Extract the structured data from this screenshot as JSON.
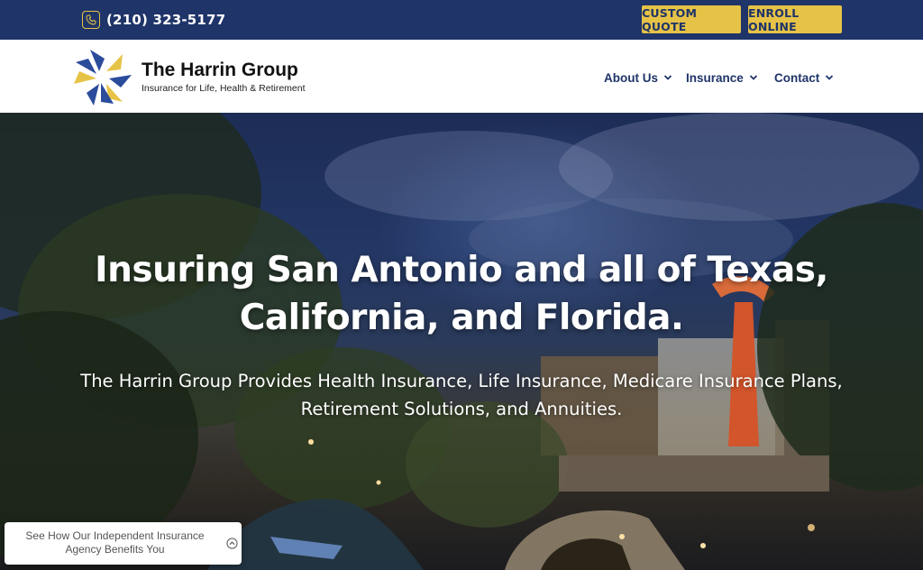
{
  "topbar": {
    "phone": "(210) 323-5177",
    "phone_icon": "phone-icon",
    "custom_quote_label": "CUSTOM QUOTE",
    "enroll_online_label": "ENROLL ONLINE"
  },
  "header": {
    "logo_title": "The Harrin Group",
    "logo_tagline": "Insurance for Life, Health & Retirement",
    "nav": [
      {
        "label": "About Us",
        "icon": "chevron-down-icon"
      },
      {
        "label": "Insurance",
        "icon": "chevron-down-icon"
      },
      {
        "label": "Contact",
        "icon": "chevron-down-icon"
      }
    ]
  },
  "hero": {
    "headline": "Insuring San Antonio and all of Texas, California, and Florida.",
    "subheadline": "The Harrin Group Provides Health Insurance, Life Insurance, Medicare Insurance Plans, Retirement Solutions, and Annuities."
  },
  "chat_widget": {
    "text": "See How Our Independent Insurance Agency Benefits You",
    "icon": "chevron-up-circle-icon"
  },
  "colors": {
    "navy": "#1f3468",
    "gold": "#e6c347",
    "white": "#ffffff"
  }
}
